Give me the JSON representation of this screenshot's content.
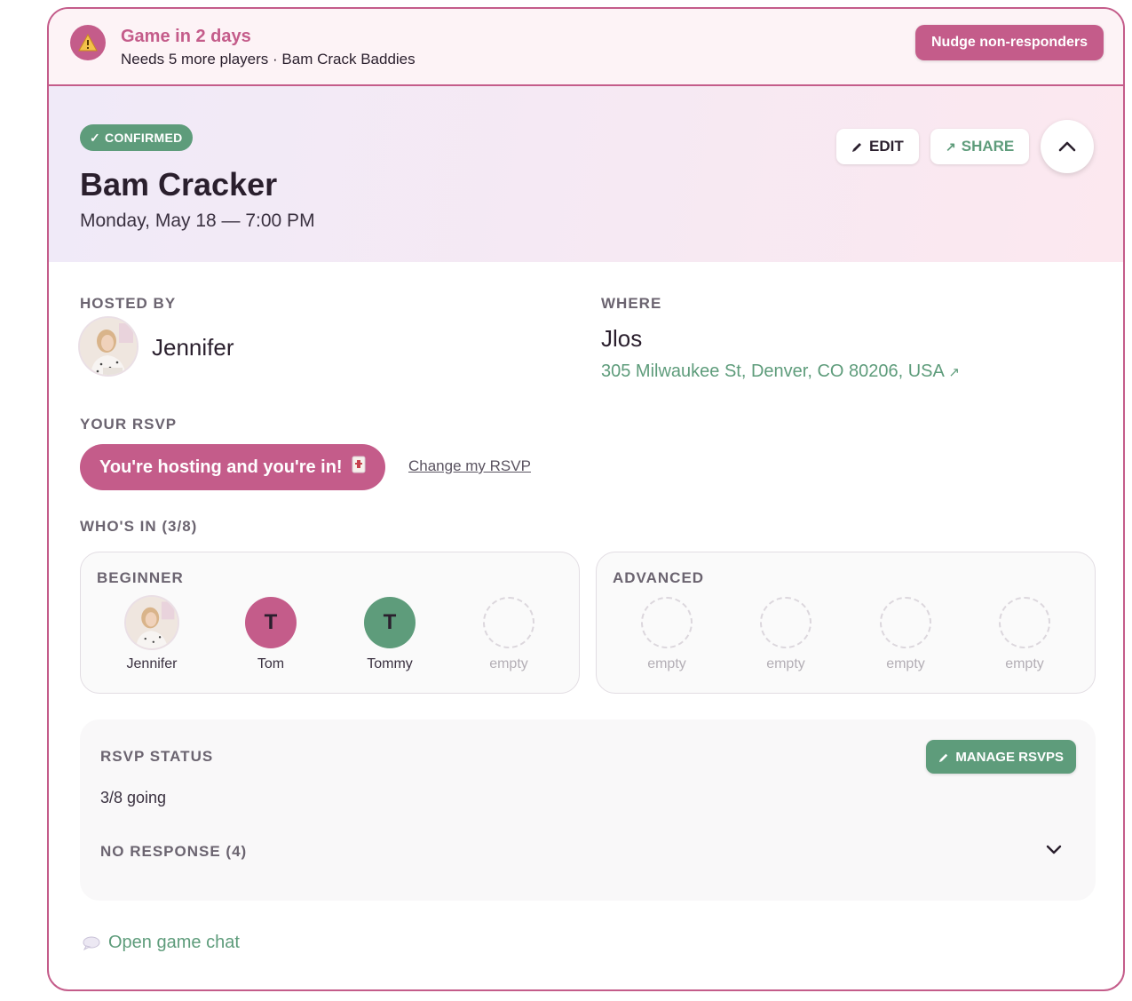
{
  "alert": {
    "title": "Game in 2 days",
    "subtitle": "Needs 5 more players · Bam Crack Baddies",
    "nudge_label": "Nudge non-responders",
    "icon": "warning-icon"
  },
  "event": {
    "status_badge": "CONFIRMED",
    "title": "Bam Cracker",
    "datetime": "Monday, May 18 — 7:00 PM",
    "edit_label": "EDIT",
    "share_label": "SHARE"
  },
  "hosted_by": {
    "label": "HOSTED BY",
    "name": "Jennifer"
  },
  "where": {
    "label": "WHERE",
    "name": "Jlos",
    "address": "305 Milwaukee St, Denver, CO 80206, USA"
  },
  "rsvp": {
    "label": "YOUR RSVP",
    "status": "You're hosting and you're in!",
    "change_label": "Change my RSVP"
  },
  "whos_in": {
    "label": "WHO'S IN (3/8)",
    "groups": [
      {
        "title": "BEGINNER",
        "slots": [
          {
            "name": "Jennifer",
            "initial": "",
            "type": "photo"
          },
          {
            "name": "Tom",
            "initial": "T",
            "color": "#c45c8a"
          },
          {
            "name": "Tommy",
            "initial": "T",
            "color": "#5e9c7b"
          },
          {
            "name": "empty",
            "initial": "",
            "type": "empty"
          }
        ]
      },
      {
        "title": "ADVANCED",
        "slots": [
          {
            "name": "empty",
            "type": "empty"
          },
          {
            "name": "empty",
            "type": "empty"
          },
          {
            "name": "empty",
            "type": "empty"
          },
          {
            "name": "empty",
            "type": "empty"
          }
        ]
      }
    ]
  },
  "rsvp_status": {
    "title": "RSVP STATUS",
    "manage_label": "MANAGE RSVPS",
    "going": "3/8 going",
    "no_response": "NO RESPONSE (4)"
  },
  "chat": {
    "label": "Open game chat"
  },
  "colors": {
    "accent_pink": "#c45c8a",
    "accent_green": "#5e9c7b"
  }
}
